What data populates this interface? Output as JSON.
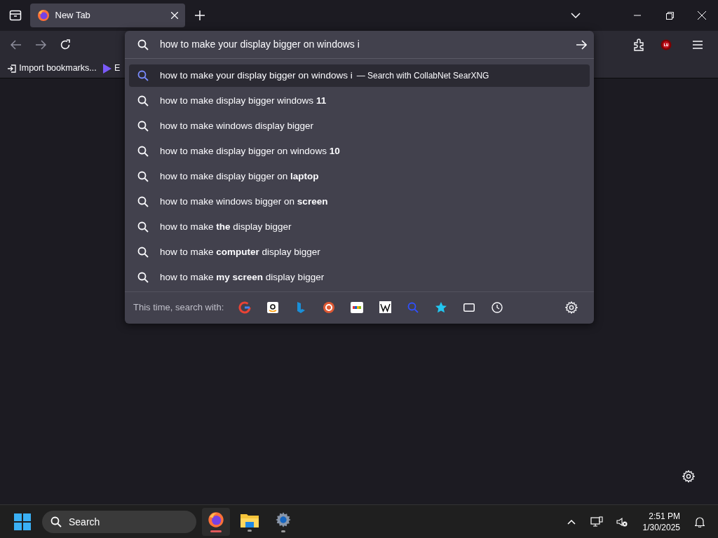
{
  "tabs": [
    {
      "title": "New Tab",
      "selected": true
    }
  ],
  "bookmarks": [
    {
      "label": "Import bookmarks...",
      "kind": "import"
    },
    {
      "label": "E",
      "kind": "app"
    }
  ],
  "urlbar": {
    "value": "how to make your display bigger on windows i"
  },
  "suggestions": [
    {
      "text": "how to make your display bigger on windows i",
      "action": "— Search with CollabNet SearXNG",
      "selected": true
    },
    {
      "text": "how to make display bigger windows **11**",
      "selected": false
    },
    {
      "text": "how to make windows display bigger",
      "selected": false
    },
    {
      "text": "how to make display bigger on windows **10**",
      "selected": false
    },
    {
      "text": "how to make display bigger on **laptop**",
      "selected": false
    },
    {
      "text": "how to make windows bigger on **screen**",
      "selected": false
    },
    {
      "text": "how to make **the** display bigger",
      "selected": false
    },
    {
      "text": "how to make **computer** display bigger",
      "selected": false
    },
    {
      "text": "how to make **my screen** display bigger",
      "selected": false
    }
  ],
  "search_with": {
    "label": "This time, search with:",
    "engines": [
      {
        "kind": "google"
      },
      {
        "kind": "amazon"
      },
      {
        "kind": "bing"
      },
      {
        "kind": "duck"
      },
      {
        "kind": "ebay"
      },
      {
        "kind": "wiki"
      },
      {
        "kind": "searx"
      },
      {
        "kind": "bookmarks"
      },
      {
        "kind": "tabs"
      },
      {
        "kind": "history"
      }
    ]
  },
  "taskbar": {
    "search_placeholder": "Search",
    "apps": [
      {
        "kind": "firefox",
        "selected": true
      },
      {
        "kind": "files",
        "selected": false
      },
      {
        "kind": "settings",
        "selected": false
      }
    ],
    "time": "2:51 PM",
    "date": "1/30/2025"
  }
}
